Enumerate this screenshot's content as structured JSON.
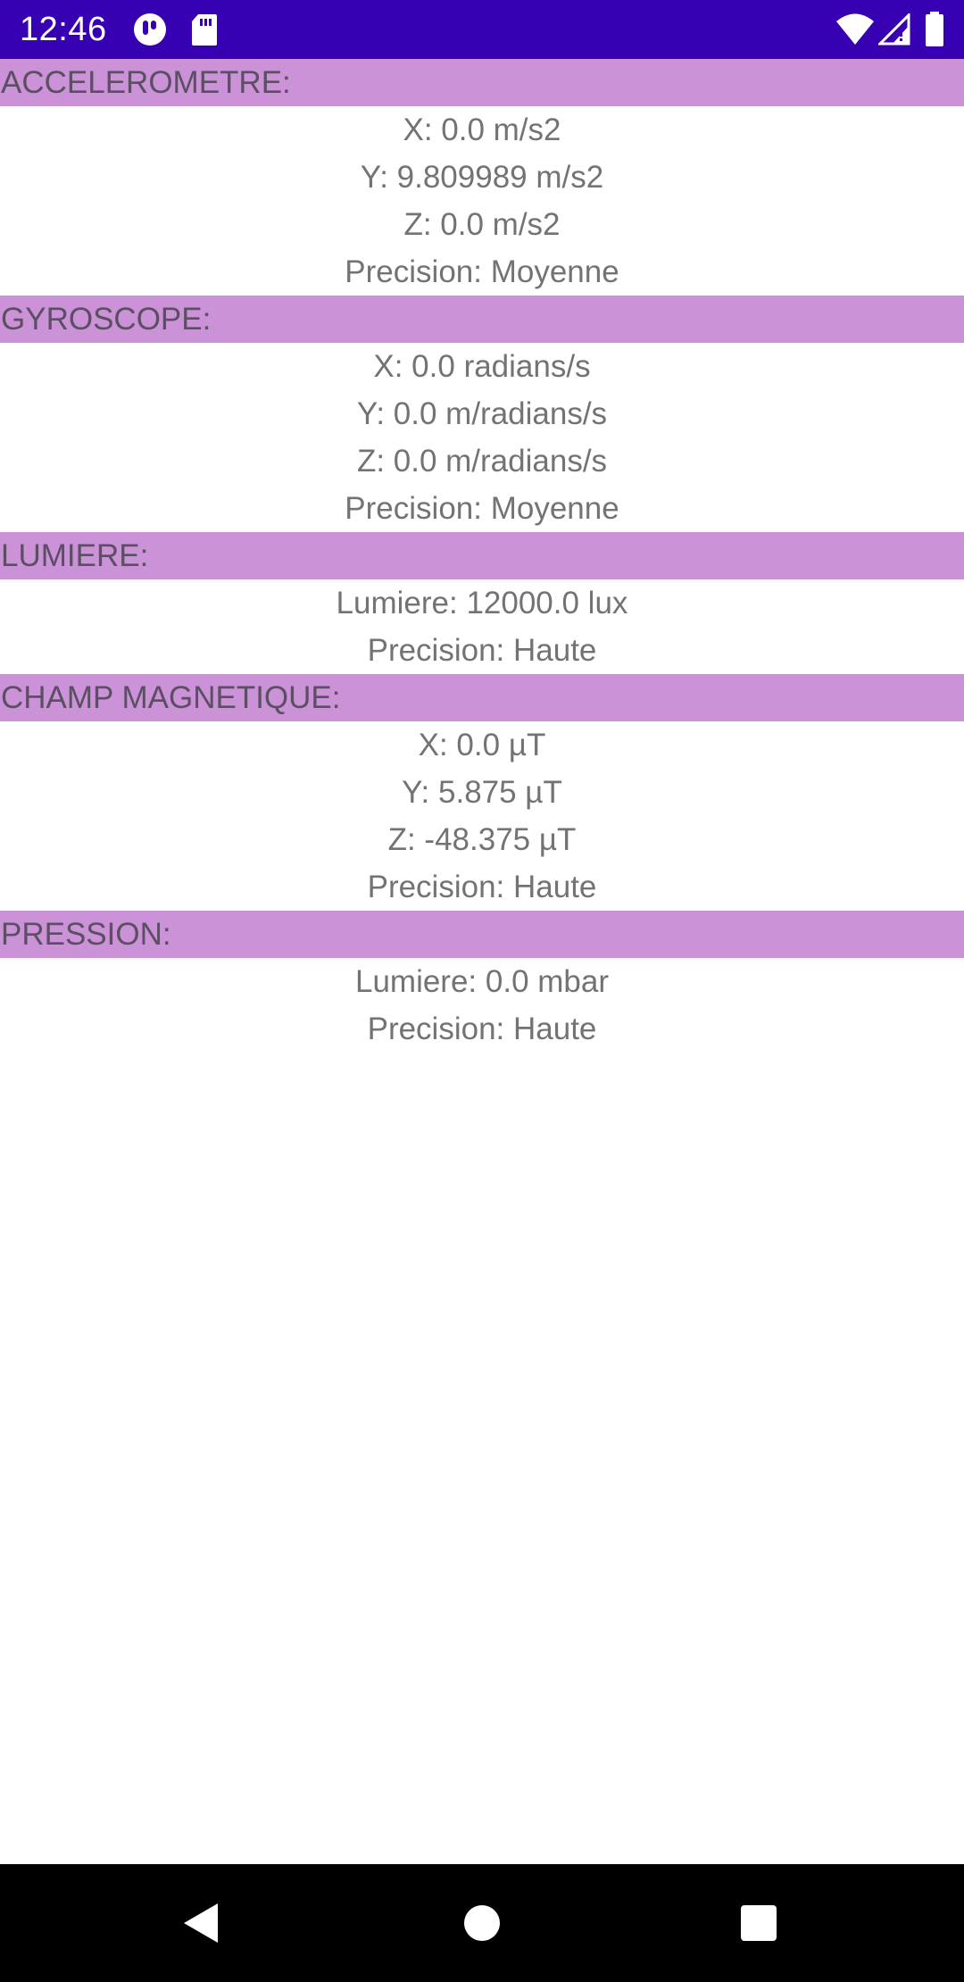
{
  "status_bar": {
    "time": "12:46",
    "background_color": "#3700b3",
    "left_icons": [
      "app-notification-icon",
      "sd-card-icon"
    ],
    "right_icons": [
      "wifi-icon",
      "cell-signal-icon",
      "battery-icon"
    ]
  },
  "colors": {
    "section_header_bg": "#cc92d8",
    "section_header_text": "#5b4f63",
    "value_text": "#737373"
  },
  "sections": [
    {
      "title": "ACCELEROMETRE:",
      "lines": [
        "X: 0.0 m/s2",
        "Y: 9.809989 m/s2",
        "Z: 0.0 m/s2",
        "Precision: Moyenne"
      ]
    },
    {
      "title": "GYROSCOPE:",
      "lines": [
        "X: 0.0 radians/s",
        "Y: 0.0 m/radians/s",
        "Z: 0.0 m/radians/s",
        "Precision: Moyenne"
      ]
    },
    {
      "title": "LUMIERE:",
      "lines": [
        "Lumiere: 12000.0 lux",
        "Precision: Haute"
      ]
    },
    {
      "title": "CHAMP MAGNETIQUE:",
      "lines": [
        "X: 0.0 µT",
        "Y: 5.875 µT",
        "Z: -48.375 µT",
        "Precision: Haute"
      ]
    },
    {
      "title": "PRESSION:",
      "lines": [
        "Lumiere: 0.0 mbar",
        "Precision: Haute"
      ]
    }
  ],
  "nav_bar": {
    "buttons": [
      "back-icon",
      "home-icon",
      "recents-icon"
    ]
  }
}
